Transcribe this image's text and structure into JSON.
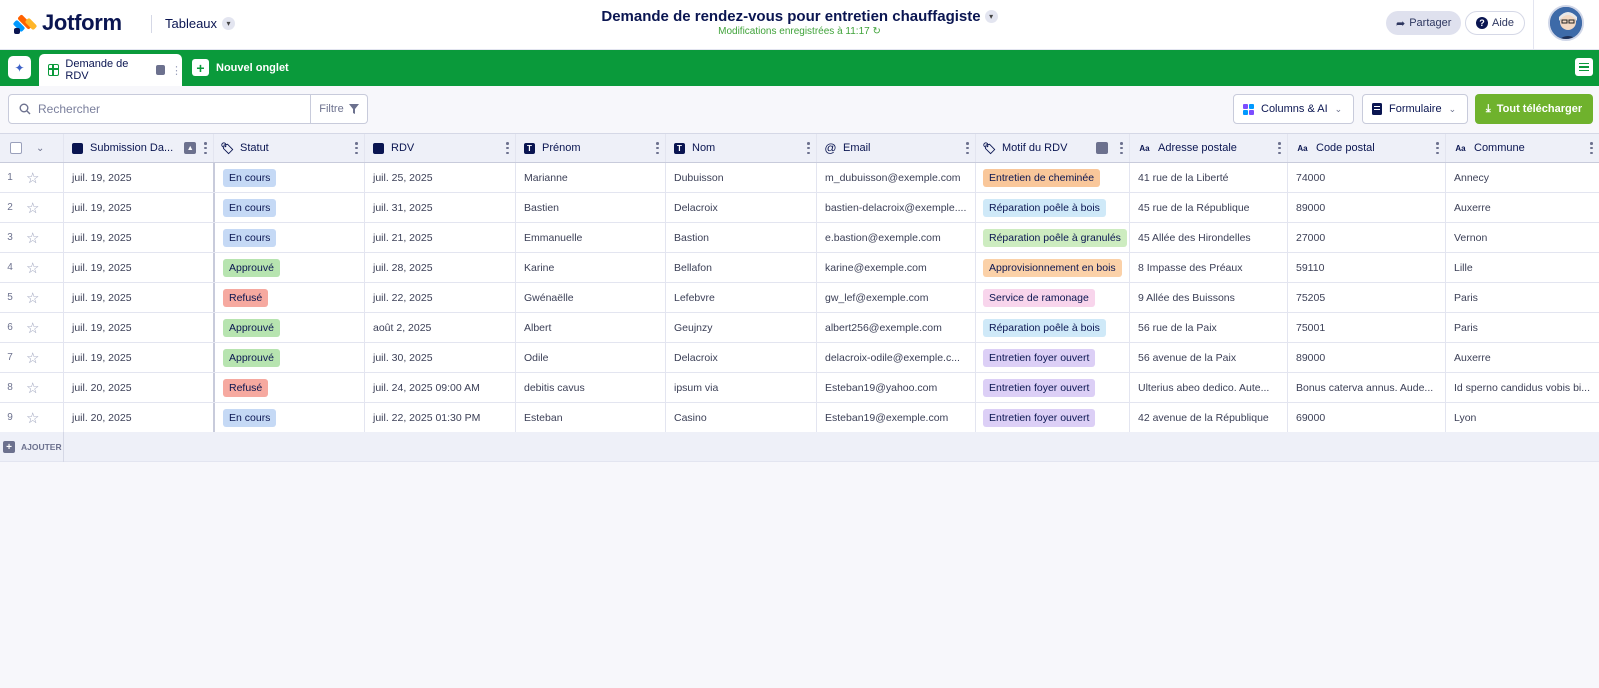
{
  "header": {
    "brand": "Jotform",
    "tables_label": "Tableaux",
    "form_title": "Demande de rendez-vous pour entretien chauffagiste",
    "saved_status": "Modifications enregistrées à 11:17",
    "share_label": "Partager",
    "help_label": "Aide"
  },
  "tabs": {
    "active_tab": "Demande de RDV",
    "new_tab_label": "Nouvel onglet"
  },
  "toolbar": {
    "search_placeholder": "Rechercher",
    "filter_label": "Filtre",
    "columns_label": "Columns & AI",
    "form_label": "Formulaire",
    "download_label": "Tout télécharger"
  },
  "columns": [
    "Submission Da...",
    "Statut",
    "RDV",
    "Prénom",
    "Nom",
    "Email",
    "Motif du RDV",
    "Adresse postale",
    "Code postal",
    "Commune"
  ],
  "colors": {
    "brand_green": "#0a9a3b",
    "download_green": "#6fb22d",
    "status_en_cours": "#c5d9f5",
    "status_approuve": "#b7e4b0",
    "status_refuse": "#f6a9a0",
    "motif_cheminee": "#f9c79a",
    "motif_poele_bois": "#cfe9f8",
    "motif_granules": "#cdecc0",
    "motif_approvisionnement": "#fbd1a8",
    "motif_ramonage": "#f8d5ec",
    "motif_foyer": "#dccff6"
  },
  "rows": [
    {
      "num": "1",
      "submission": "juil. 19, 2025",
      "statut": "En cours",
      "statut_color": "#c5d9f5",
      "rdv": "juil. 25, 2025",
      "prenom": "Marianne",
      "nom": "Dubuisson",
      "email": "m_dubuisson@exemple.com",
      "motif": "Entretien de cheminée",
      "motif_color": "#f9c79a",
      "adresse": "41 rue de la Liberté",
      "code": "74000",
      "commune": "Annecy"
    },
    {
      "num": "2",
      "submission": "juil. 19, 2025",
      "statut": "En cours",
      "statut_color": "#c5d9f5",
      "rdv": "juil. 31, 2025",
      "prenom": "Bastien",
      "nom": "Delacroix",
      "email": "bastien-delacroix@exemple....",
      "motif": "Réparation poêle à bois",
      "motif_color": "#cfe9f8",
      "adresse": "45 rue de la République",
      "code": "89000",
      "commune": "Auxerre"
    },
    {
      "num": "3",
      "submission": "juil. 19, 2025",
      "statut": "En cours",
      "statut_color": "#c5d9f5",
      "rdv": "juil. 21, 2025",
      "prenom": "Emmanuelle",
      "nom": "Bastion",
      "email": "e.bastion@exemple.com",
      "motif": "Réparation poêle à granulés",
      "motif_color": "#cdecc0",
      "adresse": "45 Allée des Hirondelles",
      "code": "27000",
      "commune": "Vernon"
    },
    {
      "num": "4",
      "submission": "juil. 19, 2025",
      "statut": "Approuvé",
      "statut_color": "#b7e4b0",
      "rdv": "juil. 28, 2025",
      "prenom": "Karine",
      "nom": "Bellafon",
      "email": "karine@exemple.com",
      "motif": "Approvisionnement en bois",
      "motif_color": "#fbd1a8",
      "adresse": "8 Impasse des Préaux",
      "code": "59110",
      "commune": "Lille"
    },
    {
      "num": "5",
      "submission": "juil. 19, 2025",
      "statut": "Refusé",
      "statut_color": "#f6a9a0",
      "rdv": "juil. 22, 2025",
      "prenom": "Gwénaëlle",
      "nom": "Lefebvre",
      "email": "gw_lef@exemple.com",
      "motif": "Service de ramonage",
      "motif_color": "#f8d5ec",
      "adresse": "9 Allée des Buissons",
      "code": "75205",
      "commune": "Paris"
    },
    {
      "num": "6",
      "submission": "juil. 19, 2025",
      "statut": "Approuvé",
      "statut_color": "#b7e4b0",
      "rdv": "août 2, 2025",
      "prenom": "Albert",
      "nom": "Geujnzy",
      "email": "albert256@exemple.com",
      "motif": "Réparation poêle à bois",
      "motif_color": "#cfe9f8",
      "adresse": "56 rue de la Paix",
      "code": "75001",
      "commune": "Paris"
    },
    {
      "num": "7",
      "submission": "juil. 19, 2025",
      "statut": "Approuvé",
      "statut_color": "#b7e4b0",
      "rdv": "juil. 30, 2025",
      "prenom": "Odile",
      "nom": "Delacroix",
      "email": "delacroix-odile@exemple.c...",
      "motif": "Entretien foyer ouvert",
      "motif_color": "#dccff6",
      "adresse": "56 avenue de la Paix",
      "code": "89000",
      "commune": "Auxerre"
    },
    {
      "num": "8",
      "submission": "juil. 20, 2025",
      "statut": "Refusé",
      "statut_color": "#f6a9a0",
      "rdv": "juil. 24, 2025 09:00 AM",
      "prenom": "debitis cavus",
      "nom": "ipsum via",
      "email": "Esteban19@yahoo.com",
      "motif": "Entretien foyer ouvert",
      "motif_color": "#dccff6",
      "adresse": "Ulterius abeo dedico. Aute...",
      "code": "Bonus caterva annus. Aude...",
      "commune": "Id sperno candidus vobis bi..."
    },
    {
      "num": "9",
      "submission": "juil. 20, 2025",
      "statut": "En cours",
      "statut_color": "#c5d9f5",
      "rdv": "juil. 22, 2025 01:30 PM",
      "prenom": "Esteban",
      "nom": "Casino",
      "email": "Esteban19@exemple.com",
      "motif": "Entretien foyer ouvert",
      "motif_color": "#dccff6",
      "adresse": "42 avenue de la République",
      "code": "69000",
      "commune": "Lyon"
    }
  ],
  "add_label": "AJOUTER"
}
